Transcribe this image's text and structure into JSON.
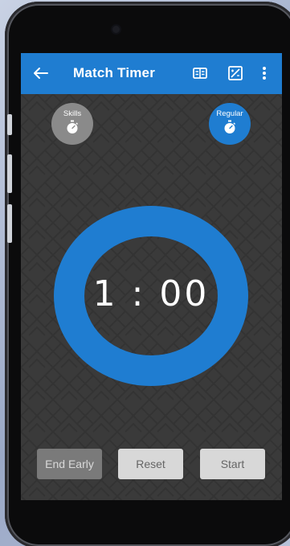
{
  "app": {
    "title": "Match Timer"
  },
  "appbar": {
    "back_icon": "arrow-left-icon",
    "actions": [
      "scoreboard-icon",
      "image-edit-icon",
      "more-vert-icon"
    ]
  },
  "modes": {
    "skills": {
      "label": "Skills",
      "icon": "stopwatch-icon",
      "selected": false
    },
    "regular": {
      "label": "Regular",
      "icon": "stopwatch-icon",
      "selected": true
    }
  },
  "timer": {
    "display": "1:00",
    "minutes": "1",
    "separator": ":",
    "seconds": "00",
    "progress": 1.0
  },
  "controls": {
    "end_early": "End Early",
    "reset": "Reset",
    "start": "Start"
  },
  "colors": {
    "accent": "#1f7dd1",
    "background": "#3a3a3a",
    "skills_button": "#8a8a8a",
    "disabled_button": "#7a7a7a",
    "light_button": "#d8d8d8"
  }
}
